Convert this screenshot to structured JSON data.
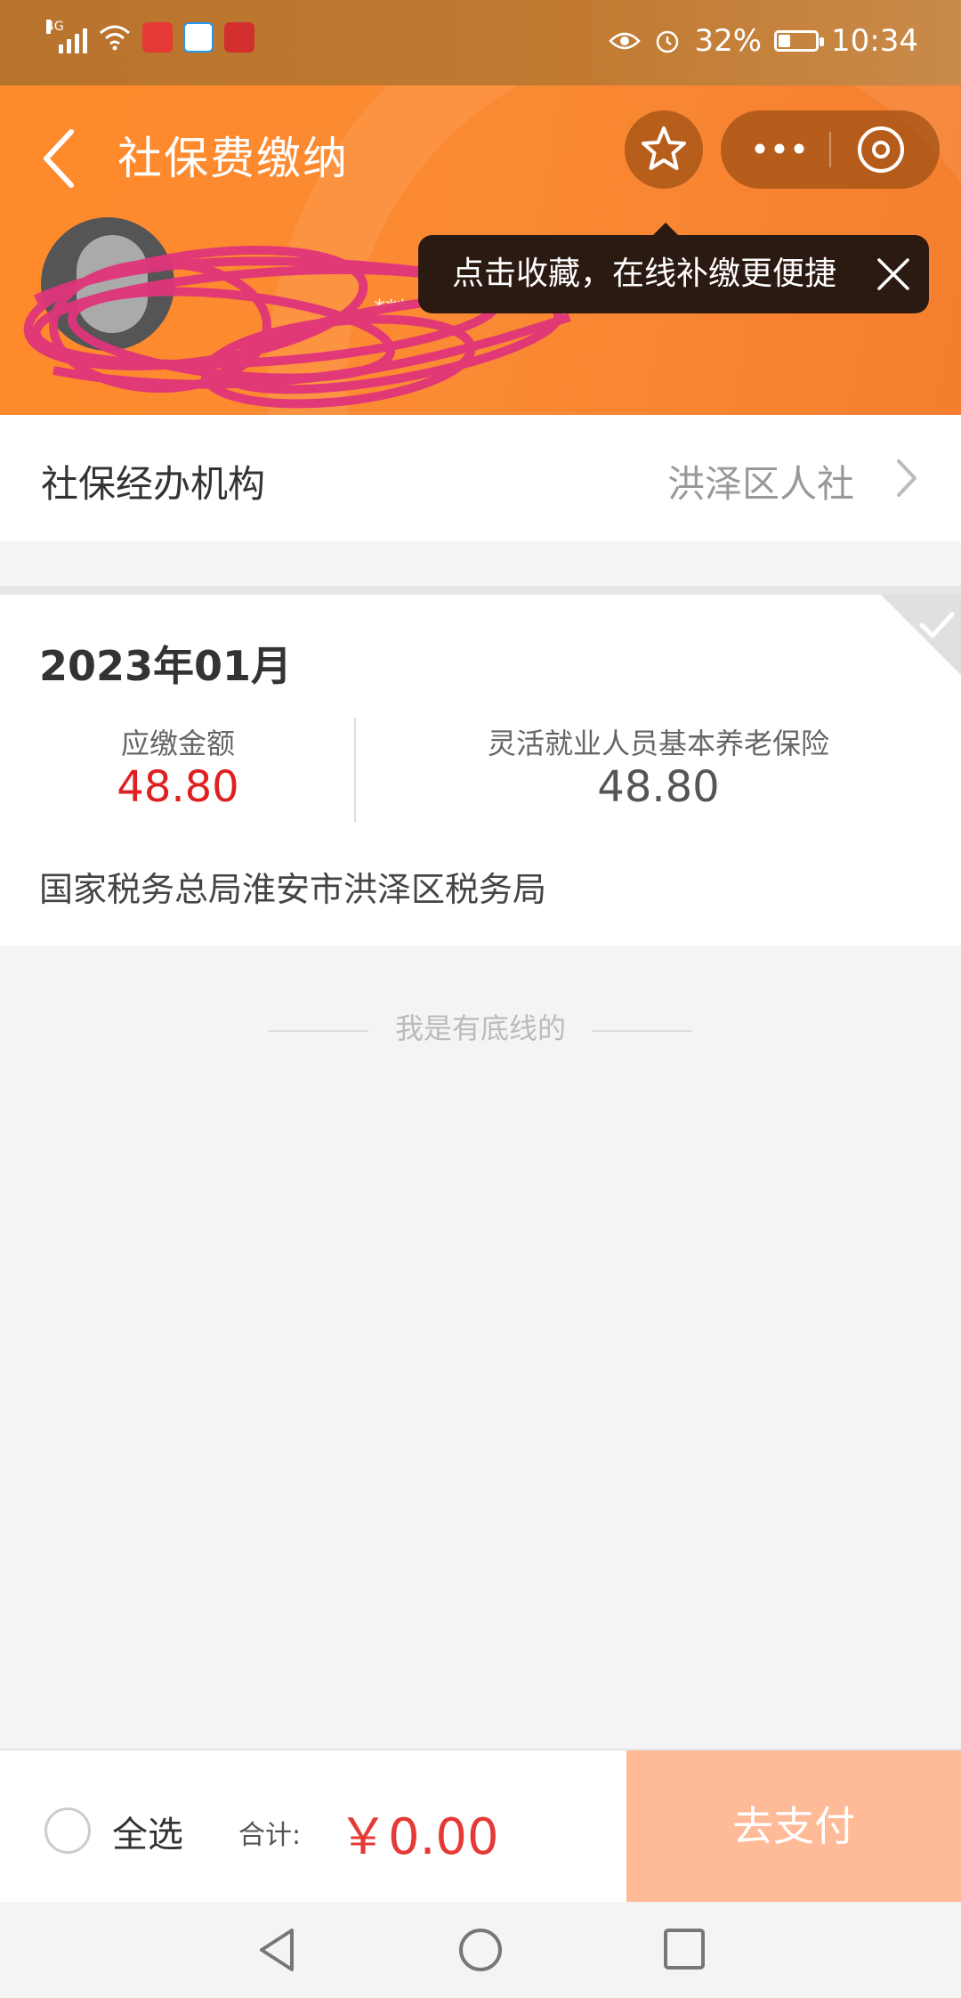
{
  "status_bar": {
    "network": "4G",
    "battery_percent": "32%",
    "battery_level": 0.32,
    "time": "10:34"
  },
  "header": {
    "title": "社保费缴纳",
    "masked_name": "***",
    "tooltip": "点击收藏，在线补缴更便捷",
    "icons": [
      "back-arrow-icon",
      "star-icon",
      "more-icon",
      "close-circle-icon",
      "close-icon"
    ]
  },
  "agency": {
    "label": "社保经办机构",
    "value": "洪泽区人社"
  },
  "payment": {
    "period": "2023年01月",
    "due_label": "应缴金额",
    "due_amount": "48.80",
    "item_label": "灵活就业人员基本养老保险",
    "item_amount": "48.80",
    "bureau": "国家税务总局淮安市洪泽区税务局",
    "selected": true
  },
  "list_end_text": "我是有底线的",
  "footer": {
    "select_all": "全选",
    "total_label": "合计:",
    "total_amount": "￥0.00",
    "pay_button": "去支付"
  },
  "colors": {
    "header": "#fb8a34",
    "status_bar": "#c17a30",
    "amount_red": "#e02020",
    "pay_button": "#ffbb98"
  }
}
